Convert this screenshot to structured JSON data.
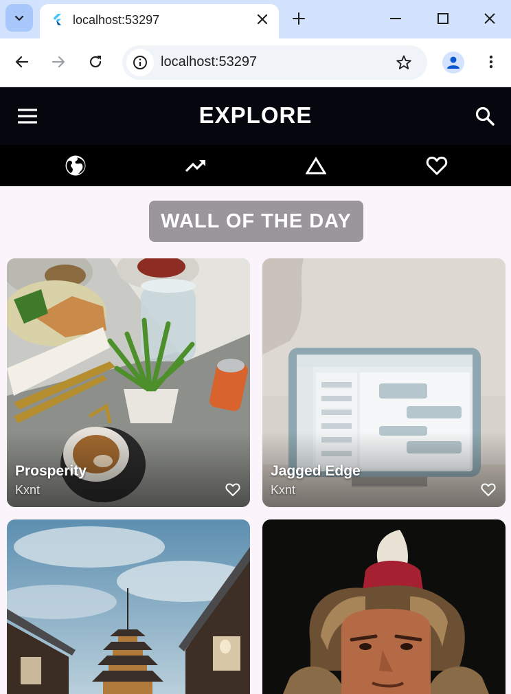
{
  "browser": {
    "tab_title": "localhost:53297",
    "url": "localhost:53297",
    "icons": [
      "tab-search-icon",
      "flutter-favicon-icon",
      "close-icon",
      "plus-icon",
      "minimize-icon",
      "maximize-icon",
      "close-window-icon",
      "back-arrow-icon",
      "forward-arrow-icon",
      "reload-icon",
      "info-icon",
      "star-icon",
      "profile-icon",
      "more-vert-icon"
    ]
  },
  "app": {
    "title": "EXPLORE",
    "category_tabs": [
      {
        "icon": "globe-icon"
      },
      {
        "icon": "trending-up-icon"
      },
      {
        "icon": "triangle-icon"
      },
      {
        "icon": "heart-icon"
      }
    ],
    "wall_of_day_label": "WALL OF THE DAY",
    "wallpapers": [
      {
        "title": "Prosperity",
        "author": "Kxnt"
      },
      {
        "title": "Jagged Edge",
        "author": "Kxnt"
      },
      {
        "title": "",
        "author": ""
      },
      {
        "title": "",
        "author": ""
      }
    ],
    "colors": {
      "appbar": "#06060e",
      "background": "#fbf4fb",
      "wotd_chip": "#9a969c"
    }
  }
}
